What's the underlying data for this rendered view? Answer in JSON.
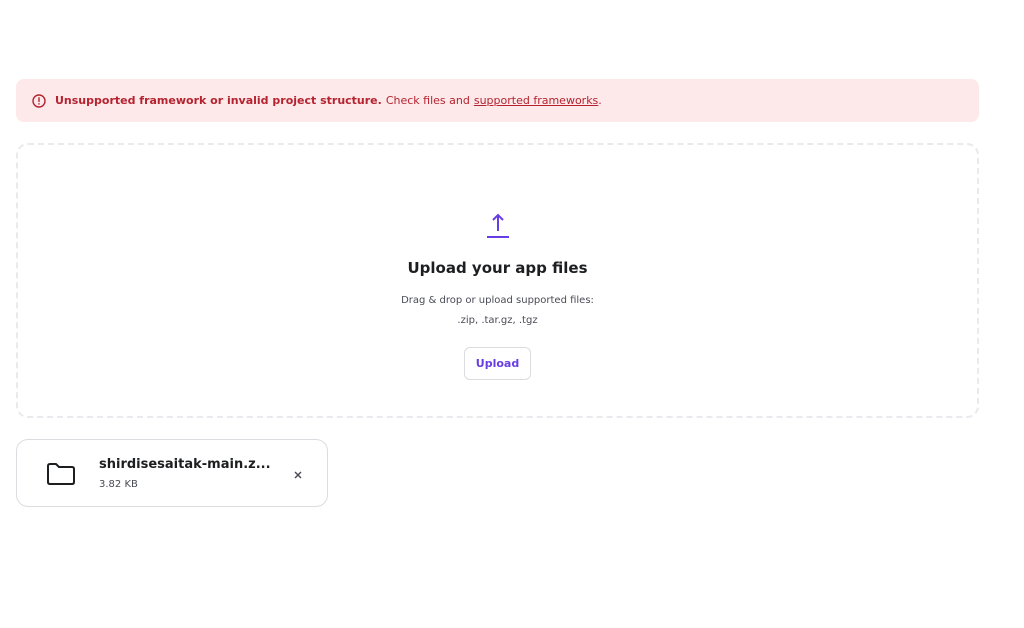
{
  "alert": {
    "title": "Unsupported framework or invalid project structure.",
    "message": "Check files and",
    "link": "supported frameworks",
    "suffix": ".",
    "icon": "info-icon",
    "color": "#b4232f",
    "background": "#fde8ea"
  },
  "dropzone": {
    "icon": "upload-icon",
    "title": "Upload your app files",
    "subtitle_line1": "Drag & drop or upload supported files:",
    "subtitle_line2": ".zip, .tar.gz, .tgz",
    "button_label": "Upload",
    "accent": "#673de6"
  },
  "file": {
    "icon": "folder-icon",
    "name": "shirdisesaitak-main.z...",
    "size": "3.82 KB",
    "remove_icon": "close-icon"
  }
}
